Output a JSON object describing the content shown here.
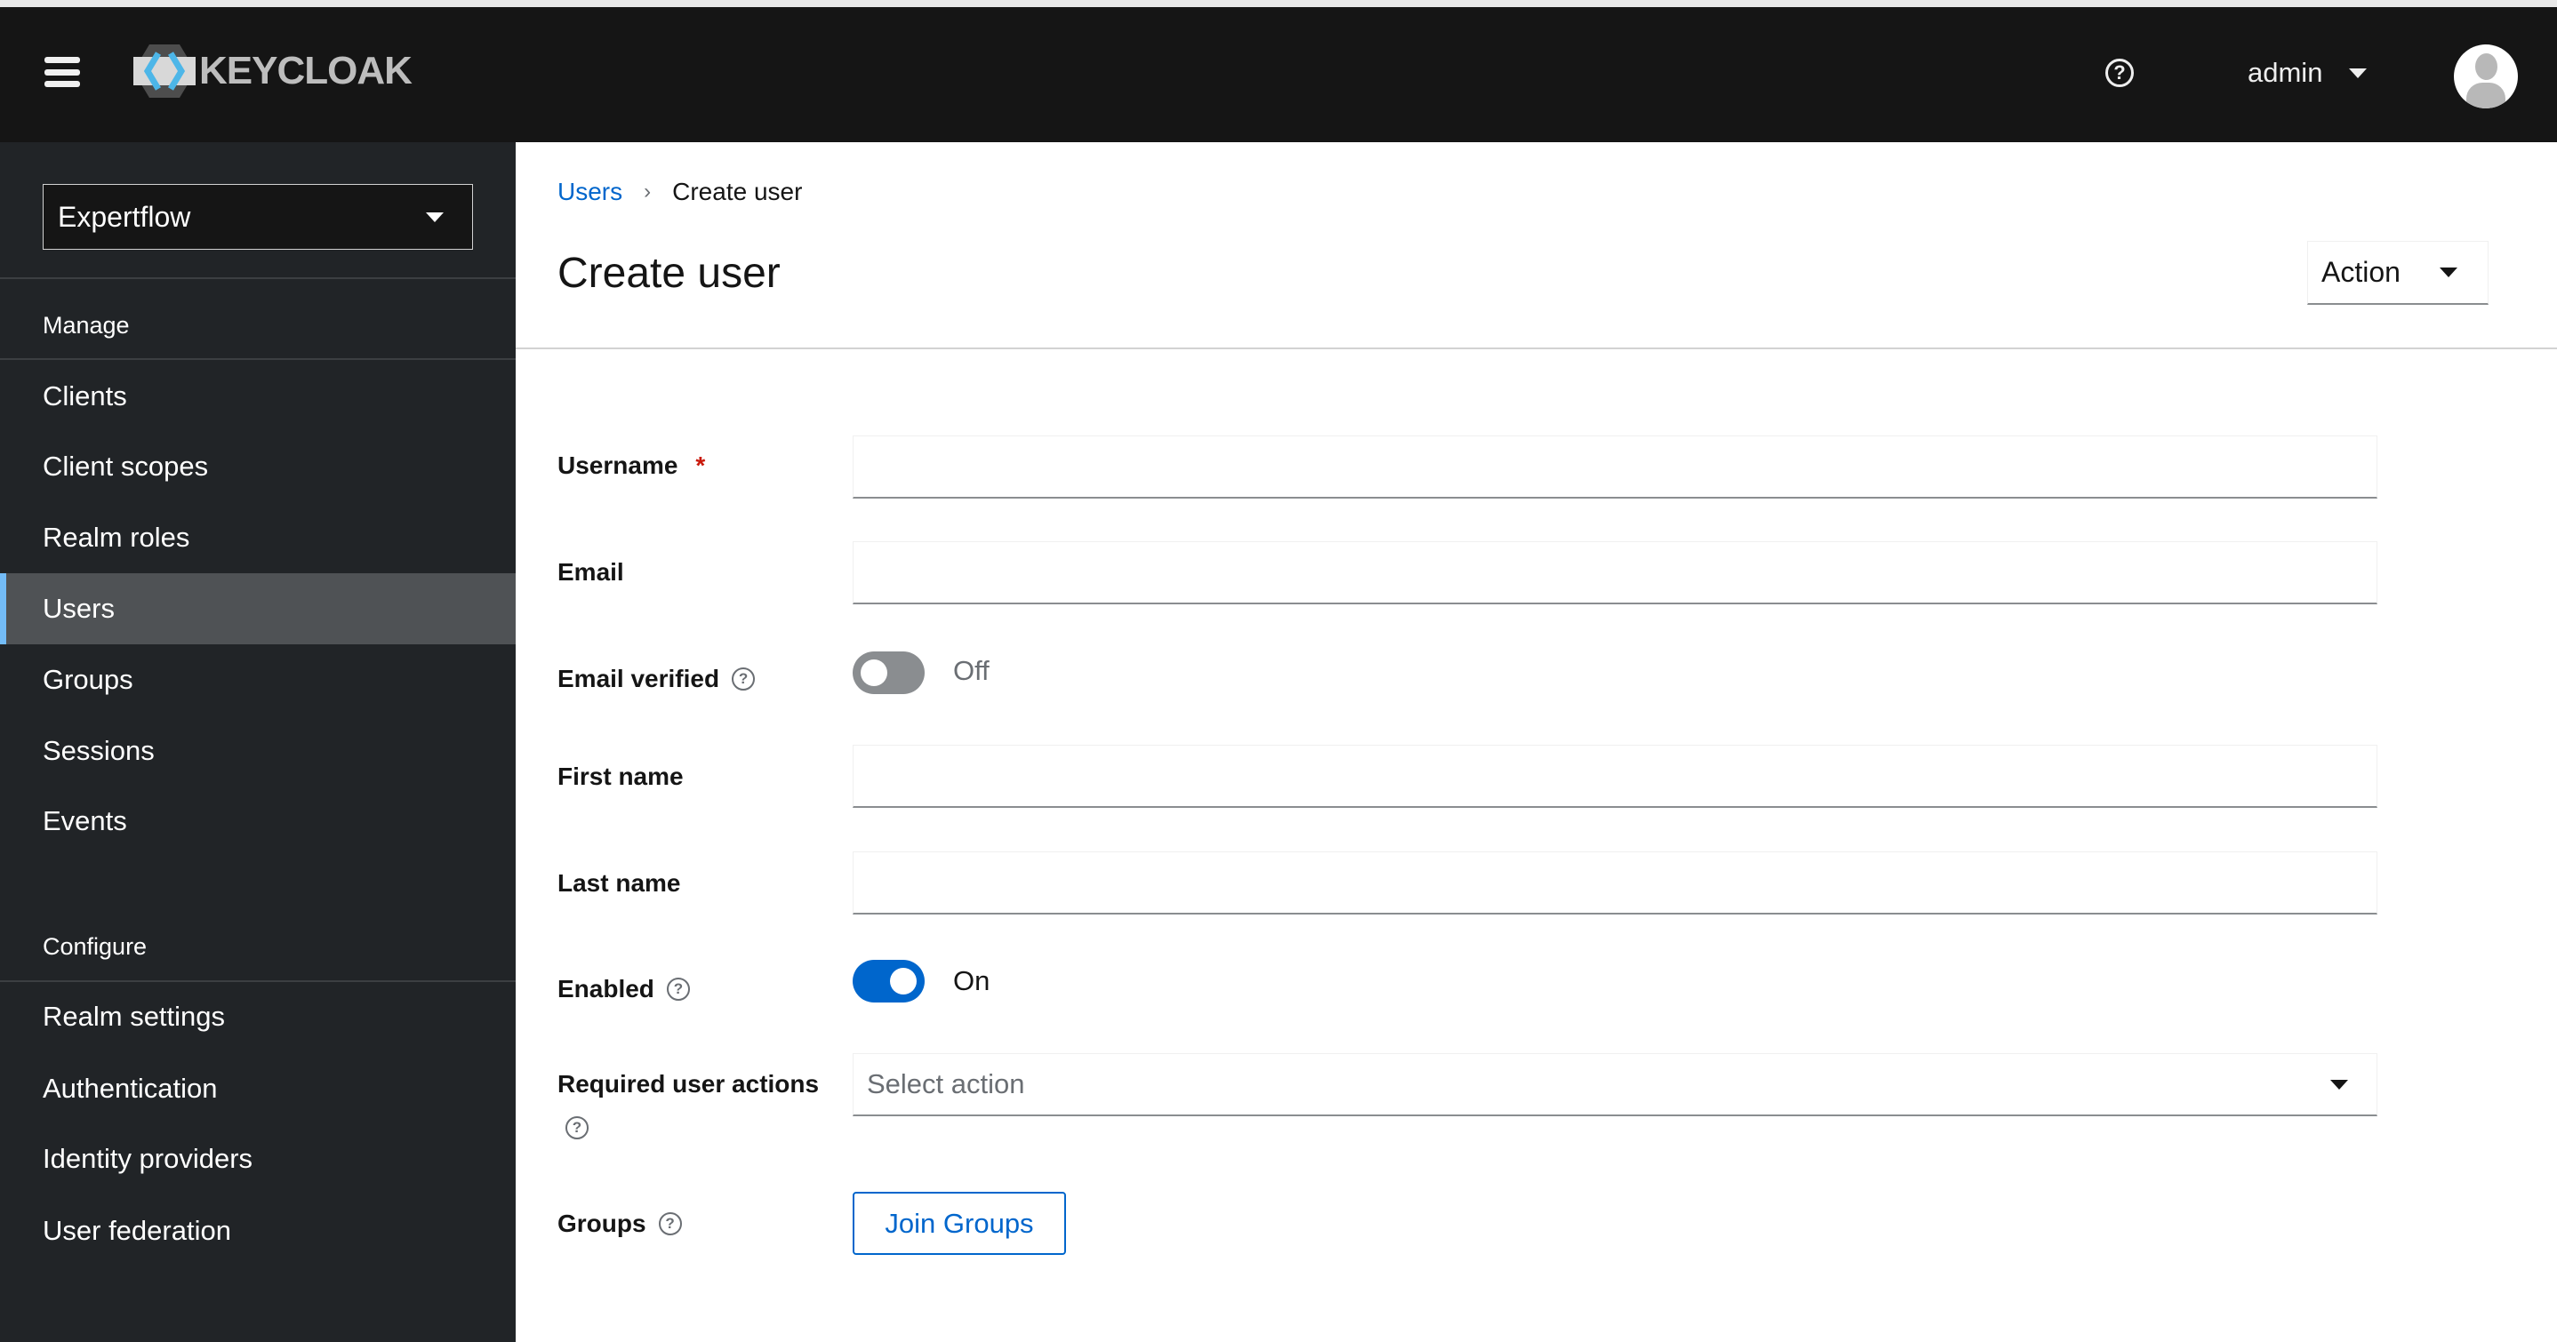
{
  "header": {
    "logo_text": "KEYCLOAK",
    "user": "admin"
  },
  "sidebar": {
    "realm": "Expertflow",
    "sections": [
      {
        "label": "Manage",
        "items": [
          "Clients",
          "Client scopes",
          "Realm roles",
          "Users",
          "Groups",
          "Sessions",
          "Events"
        ]
      },
      {
        "label": "Configure",
        "items": [
          "Realm settings",
          "Authentication",
          "Identity providers",
          "User federation"
        ]
      }
    ],
    "active": "Users"
  },
  "breadcrumb": {
    "parent": "Users",
    "current": "Create user"
  },
  "page": {
    "title": "Create user",
    "action_label": "Action"
  },
  "form": {
    "username_label": "Username",
    "required_mark": "*",
    "username_value": "",
    "email_label": "Email",
    "email_value": "",
    "email_verified_label": "Email verified",
    "email_verified_state": "Off",
    "first_name_label": "First name",
    "first_name_value": "",
    "last_name_label": "Last name",
    "last_name_value": "",
    "enabled_label": "Enabled",
    "enabled_state": "On",
    "required_actions_label": "Required user actions",
    "required_actions_placeholder": "Select action",
    "groups_label": "Groups",
    "join_groups_label": "Join Groups"
  },
  "colors": {
    "accent": "#0066cc",
    "header_bg": "#151515",
    "sidebar_bg": "#212427",
    "toggle_on": "#0066cc",
    "toggle_off": "#8a8d90"
  }
}
